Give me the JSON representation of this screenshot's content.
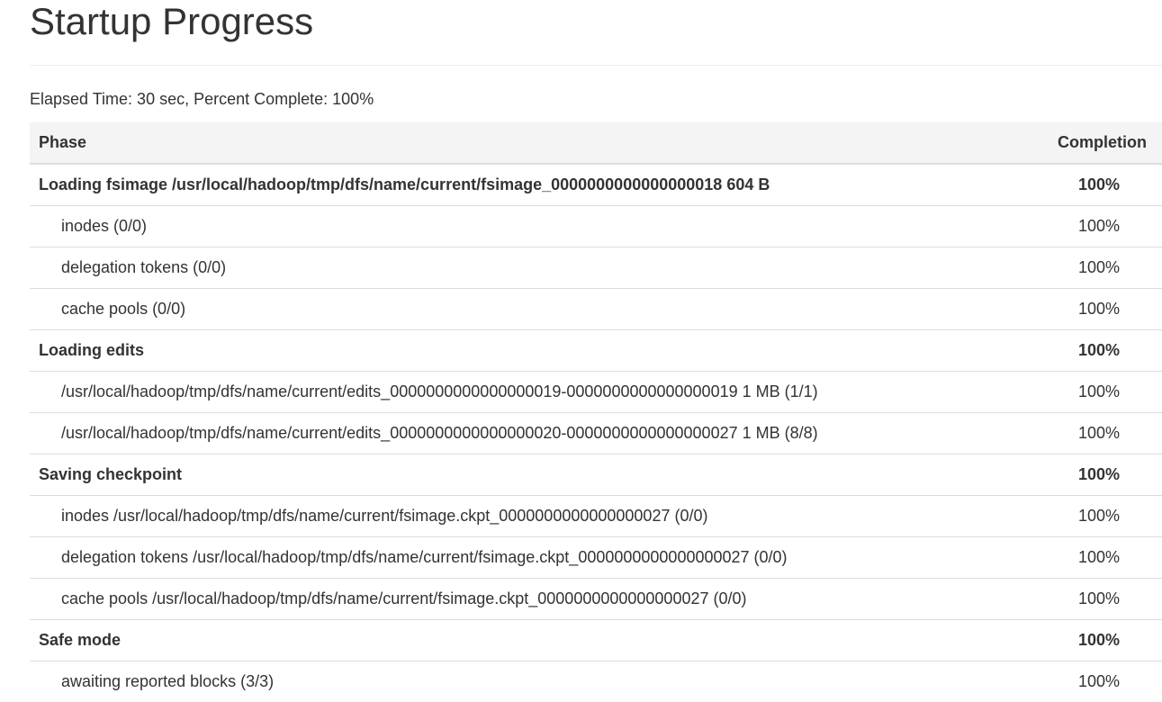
{
  "page": {
    "title": "Startup Progress",
    "summary": "Elapsed Time: 30 sec, Percent Complete: 100%"
  },
  "table": {
    "headers": {
      "phase": "Phase",
      "completion": "Completion"
    },
    "rows": [
      {
        "kind": "phase",
        "name": "Loading fsimage /usr/local/hadoop/tmp/dfs/name/current/fsimage_0000000000000000018 604 B",
        "completion": "100%"
      },
      {
        "kind": "step",
        "name": "inodes (0/0)",
        "completion": "100%"
      },
      {
        "kind": "step",
        "name": "delegation tokens (0/0)",
        "completion": "100%"
      },
      {
        "kind": "step",
        "name": "cache pools (0/0)",
        "completion": "100%"
      },
      {
        "kind": "phase",
        "name": "Loading edits",
        "completion": "100%"
      },
      {
        "kind": "step",
        "name": "/usr/local/hadoop/tmp/dfs/name/current/edits_0000000000000000019-0000000000000000019 1 MB (1/1)",
        "completion": "100%"
      },
      {
        "kind": "step",
        "name": "/usr/local/hadoop/tmp/dfs/name/current/edits_0000000000000000020-0000000000000000027 1 MB (8/8)",
        "completion": "100%"
      },
      {
        "kind": "phase",
        "name": "Saving checkpoint",
        "completion": "100%"
      },
      {
        "kind": "step",
        "name": "inodes /usr/local/hadoop/tmp/dfs/name/current/fsimage.ckpt_0000000000000000027 (0/0)",
        "completion": "100%"
      },
      {
        "kind": "step",
        "name": "delegation tokens /usr/local/hadoop/tmp/dfs/name/current/fsimage.ckpt_0000000000000000027 (0/0)",
        "completion": "100%"
      },
      {
        "kind": "step",
        "name": "cache pools /usr/local/hadoop/tmp/dfs/name/current/fsimage.ckpt_0000000000000000027 (0/0)",
        "completion": "100%"
      },
      {
        "kind": "phase",
        "name": "Safe mode",
        "completion": "100%"
      },
      {
        "kind": "step",
        "name": "awaiting reported blocks (3/3)",
        "completion": "100%"
      }
    ]
  }
}
